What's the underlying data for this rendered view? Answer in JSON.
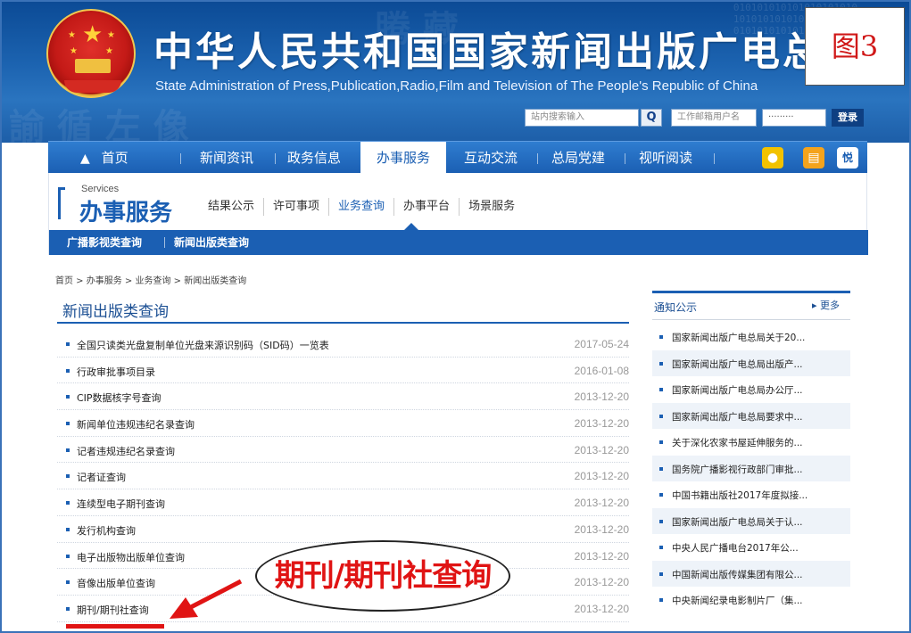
{
  "header": {
    "title": "中华人民共和国国家新闻出版广电总",
    "subtitle": "State Administration of Press,Publication,Radio,Film and Television of The People's Republic of China",
    "search_placeholder": "站内搜索输入",
    "mail_user_placeholder": "工作邮箱用户名",
    "mail_password_mask": "·········",
    "login_label": "登录",
    "figure_label": "图3"
  },
  "nav": {
    "items": [
      "首页",
      "新闻资讯",
      "政务信息",
      "办事服务",
      "互动交流",
      "总局党建",
      "视听阅读"
    ],
    "active": "办事服务"
  },
  "services": {
    "en_label": "Services",
    "cn_label": "办事服务",
    "tabs": [
      "结果公示",
      "许可事项",
      "业务查询",
      "办事平台",
      "场景服务"
    ],
    "active_tab": "业务查询",
    "sub_tabs": [
      "广播影视类查询",
      "新闻出版类查询"
    ]
  },
  "breadcrumb": "首页 > 办事服务 > 业务查询 > 新闻出版类查询",
  "main": {
    "title": "新闻出版类查询",
    "items": [
      {
        "title": "全国只读类光盘复制单位光盘来源识别码（SID码）一览表",
        "date": "2017-05-24"
      },
      {
        "title": "行政审批事项目录",
        "date": "2016-01-08"
      },
      {
        "title": "CIP数据核字号查询",
        "date": "2013-12-20"
      },
      {
        "title": "新闻单位违规违纪名录查询",
        "date": "2013-12-20"
      },
      {
        "title": "记者违规违纪名录查询",
        "date": "2013-12-20"
      },
      {
        "title": "记者证查询",
        "date": "2013-12-20"
      },
      {
        "title": "连续型电子期刊查询",
        "date": "2013-12-20"
      },
      {
        "title": "发行机构查询",
        "date": "2013-12-20"
      },
      {
        "title": "电子出版物出版单位查询",
        "date": "2013-12-20"
      },
      {
        "title": "音像出版单位查询",
        "date": "2013-12-20"
      },
      {
        "title": "期刊/期刊社查询",
        "date": "2013-12-20"
      }
    ]
  },
  "notices": {
    "title": "通知公示",
    "more": "▸ 更多",
    "items": [
      "国家新闻出版广电总局关于20...",
      "国家新闻出版广电总局出版产...",
      "国家新闻出版广电总局办公厅...",
      "国家新闻出版广电总局要求中...",
      "关于深化农家书屋延伸服务的...",
      "国务院广播影视行政部门审批...",
      "中国书籍出版社2017年度拟接...",
      "国家新闻出版广电总局关于认...",
      "中央人民广播电台2017年公...",
      "中国新闻出版传媒集团有限公...",
      "中央新闻纪录电影制片厂（集..."
    ]
  },
  "annotation": {
    "text": "期刊/期刊社查询",
    "color": "#e01414"
  },
  "colors": {
    "brand_blue": "#1b5fb3",
    "banner_blue": "#0b4a95",
    "annotation_red": "#e01414"
  }
}
